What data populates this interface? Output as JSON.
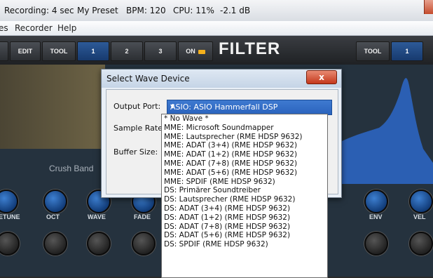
{
  "titlebar": {
    "recording": "Recording: 4 sec",
    "preset": "My Preset",
    "bpm": "BPM: 120",
    "cpu": "CPU: 11%",
    "level": "-2.1 dB"
  },
  "menu": [
    "es",
    "Recorder",
    "Help"
  ],
  "toolbar": {
    "edit": "EDIT",
    "tool": "TOOL",
    "pages": [
      "1",
      "2",
      "3"
    ],
    "on": "ON",
    "title": "FILTER",
    "tool_right": "TOOL",
    "page_right": "1"
  },
  "panel": {
    "band_label": "Crush Band",
    "knob_labels": [
      "ETUNE",
      "OCT",
      "WAVE",
      "FADE",
      "ENV",
      "VEL"
    ]
  },
  "dialog": {
    "title": "Select Wave Device",
    "close": "x",
    "output_port_label": "Output Port:",
    "output_port_value": "ASIO: ASIO Hammerfall DSP",
    "sample_rate_label": "Sample Rate:",
    "buffer_size_label": "Buffer Size:"
  },
  "dropdown_options": [
    "* No Wave *",
    "MME: Microsoft Soundmapper",
    "MME: Lautsprecher (RME HDSP 9632)",
    "MME: ADAT (3+4) (RME HDSP 9632)",
    "MME: ADAT (1+2) (RME HDSP 9632)",
    "MME: ADAT (7+8) (RME HDSP 9632)",
    "MME: ADAT (5+6) (RME HDSP 9632)",
    "MME: SPDIF (RME HDSP 9632)",
    "DS: Primärer Soundtreiber",
    "DS: Lautsprecher (RME HDSP 9632)",
    "DS: ADAT (3+4) (RME HDSP 9632)",
    "DS: ADAT (1+2) (RME HDSP 9632)",
    "DS: ADAT (7+8) (RME HDSP 9632)",
    "DS: ADAT (5+6) (RME HDSP 9632)",
    "DS: SPDIF (RME HDSP 9632)"
  ],
  "colors": {
    "accent_blue": "#2a63bd",
    "led": "#f4b01c",
    "spectrum": "#2b5fb3"
  }
}
